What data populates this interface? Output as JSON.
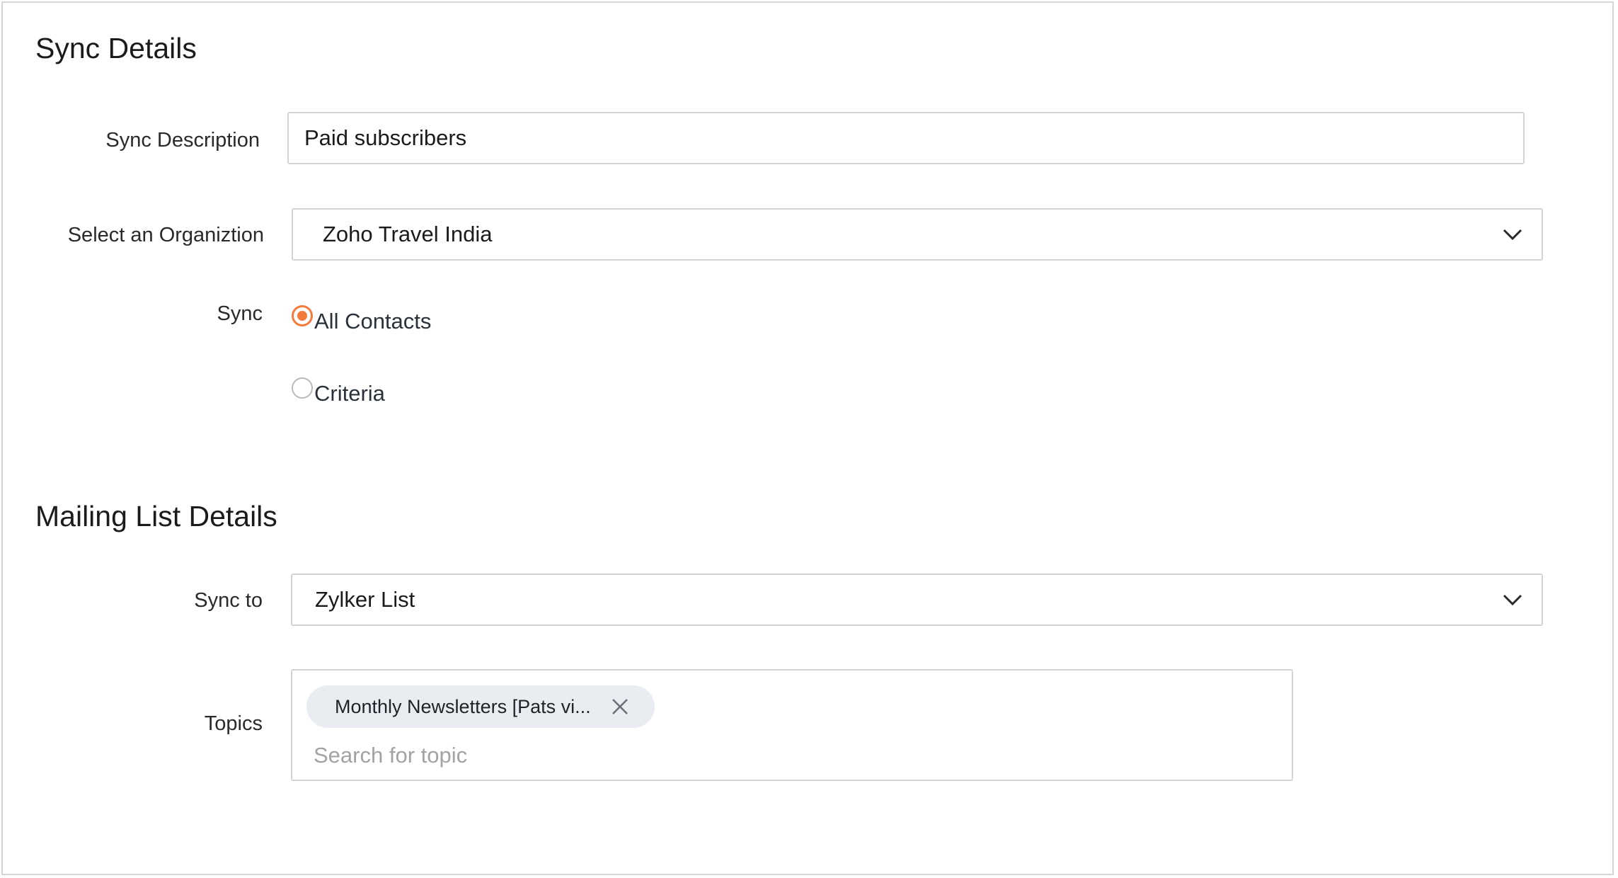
{
  "sync_details": {
    "title": "Sync Details",
    "description_label": "Sync Description",
    "description_value": "Paid subscribers",
    "organization_label": "Select an Organiztion",
    "organization_value": "Zoho Travel India",
    "sync_label": "Sync",
    "sync_options": [
      {
        "label": "All Contacts",
        "selected": true
      },
      {
        "label": "Criteria",
        "selected": false
      }
    ]
  },
  "mailing_list_details": {
    "title": "Mailing List Details",
    "sync_to_label": "Sync to",
    "sync_to_value": "Zylker List",
    "topics_label": "Topics",
    "topics": [
      {
        "label": "Monthly Newsletters [Pats vi..."
      }
    ],
    "topic_search_placeholder": "Search for topic"
  },
  "colors": {
    "accent": "#f37b3c",
    "border": "#d3d3d3",
    "chip_bg": "#e9ecf1"
  },
  "icons": {
    "dropdown": "chevron-down-icon",
    "remove_chip": "close-icon"
  }
}
